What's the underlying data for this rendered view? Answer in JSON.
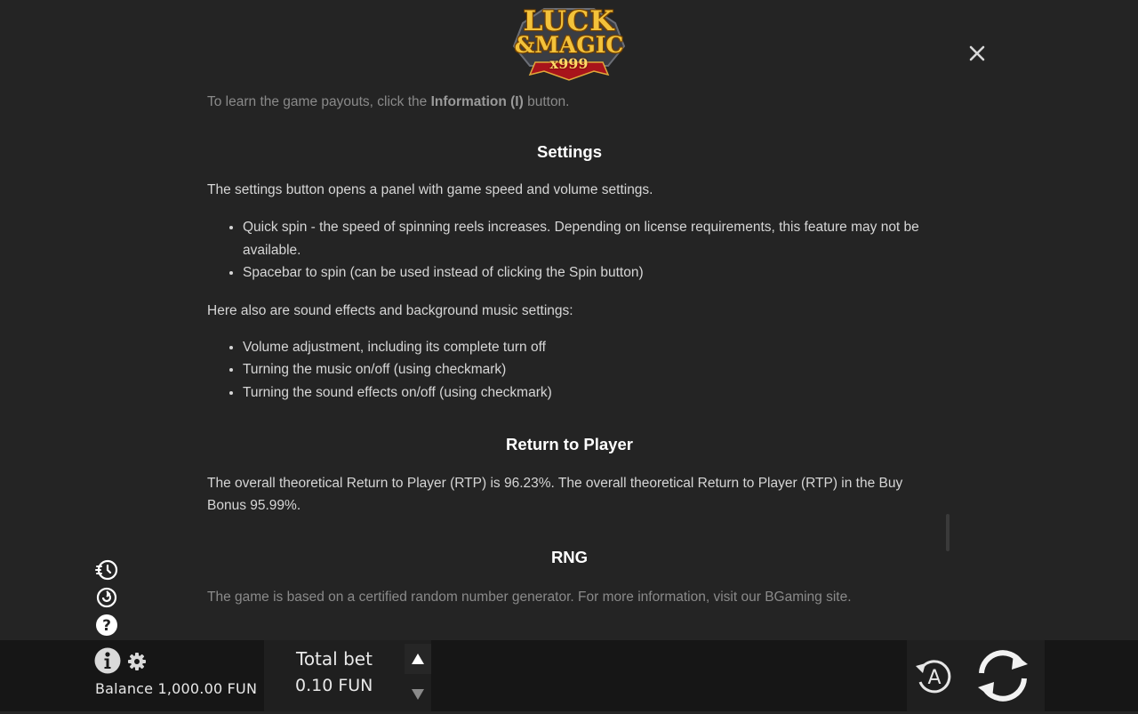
{
  "logo": {
    "line1": "LUCK",
    "line2": "&MAGIC",
    "line3": "x999"
  },
  "rules": {
    "intro": {
      "pre": "To learn the game payouts, click the ",
      "bold": "Information (I)",
      "post": " button."
    },
    "settings": {
      "heading": "Settings",
      "text1": "The settings button opens a panel with game speed and volume settings.",
      "list1": [
        "Quick spin - the speed of spinning reels increases. Depending on license requirements, this feature may not be available.",
        "Spacebar to spin (can be used instead of clicking the Spin button)"
      ],
      "text2": "Here also are sound effects and background music settings:",
      "list2": [
        "Volume adjustment, including its complete turn off",
        "Turning the music on/off (using checkmark)",
        "Turning the sound effects on/off (using checkmark)"
      ]
    },
    "rtp": {
      "heading": "Return to Player",
      "text": "The overall theoretical Return to Player (RTP) is 96.23%. The overall theoretical Return to Player (RTP) in the Buy Bonus 95.99%."
    },
    "rng": {
      "heading": "RNG",
      "text": "The game is based on a certified random number generator. For more information, visit our BGaming site."
    }
  },
  "bottom": {
    "balance": "Balance 1,000.00 FUN",
    "total_bet_label": "Total bet",
    "total_bet_value": "0.10 FUN"
  },
  "colors": {
    "background": "#242424",
    "bottom_bar": "#161616",
    "heading": "#ffffff",
    "text": "#d6d6d6",
    "logo_gold": "#f3c23a"
  },
  "icons": {
    "close": "close-icon",
    "side": [
      "turbo-icon",
      "history-icon",
      "help-icon"
    ],
    "info": "info-icon",
    "settings": "gear-icon",
    "bet_up": "triangle-up-icon",
    "bet_down": "triangle-down-icon",
    "auto": "autoplay-icon",
    "spin": "spin-icon"
  }
}
